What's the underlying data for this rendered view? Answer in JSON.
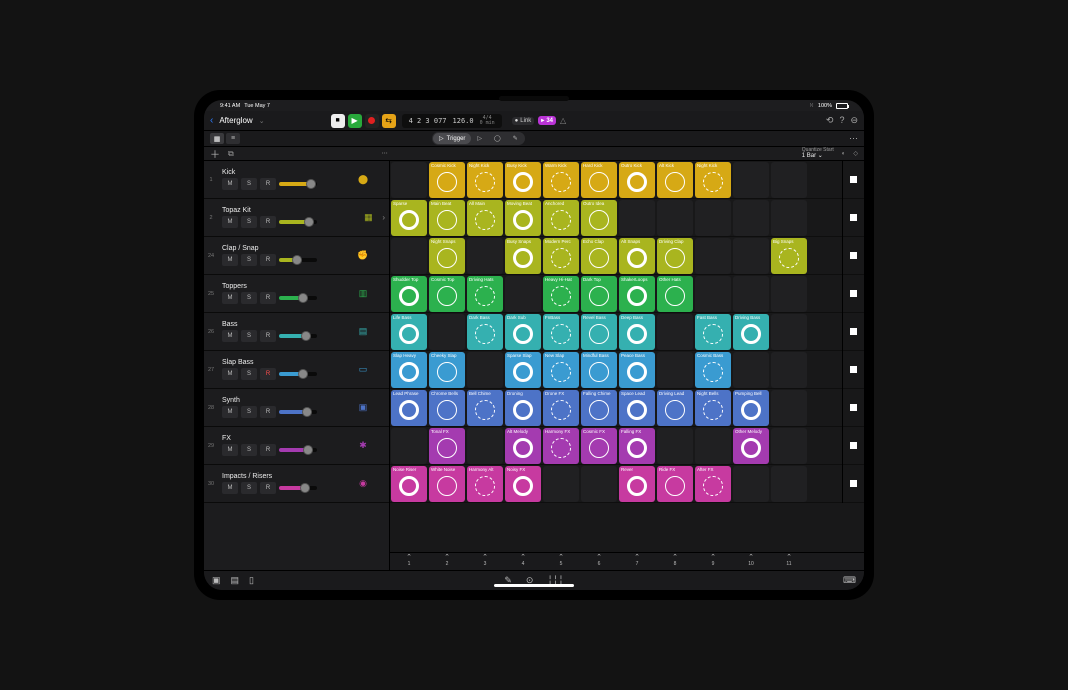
{
  "status": {
    "time": "9:41 AM",
    "date": "Tue May 7",
    "battery": "100%"
  },
  "project": {
    "title": "Afterglow"
  },
  "transport": {
    "position": "4 2 3 077",
    "tempo": "126.0",
    "sig": "4/4",
    "elapsed": "0 min",
    "link_label": "Link",
    "take": "34"
  },
  "subbar": {
    "trigger": "Trigger"
  },
  "info": {
    "quantize_label": "Quantize Start",
    "quantize_value": "1 Bar"
  },
  "colors": {
    "yellow": "#d6a915",
    "olive": "#a9b51f",
    "green": "#2cb14e",
    "teal": "#35b0b0",
    "sky": "#3a9bd1",
    "blue": "#4d73c7",
    "purple": "#a43bb0",
    "magenta": "#c73aa0"
  },
  "tracks": [
    {
      "num": "1",
      "name": "Kick",
      "color": "yellow",
      "icon": "⬤",
      "fader": 0.78
    },
    {
      "num": "2",
      "name": "Topaz Kit",
      "color": "olive",
      "icon": "▦",
      "fader": 0.72,
      "expand": true
    },
    {
      "num": "24",
      "name": "Clap / Snap",
      "color": "olive",
      "icon": "✊",
      "fader": 0.4
    },
    {
      "num": "25",
      "name": "Toppers",
      "color": "green",
      "icon": "▥",
      "fader": 0.56
    },
    {
      "num": "26",
      "name": "Bass",
      "color": "teal",
      "icon": "▤",
      "fader": 0.64
    },
    {
      "num": "27",
      "name": "Slap Bass",
      "color": "sky",
      "icon": "▭",
      "fader": 0.55,
      "rec": true
    },
    {
      "num": "28",
      "name": "Synth",
      "color": "blue",
      "icon": "▣",
      "fader": 0.66
    },
    {
      "num": "29",
      "name": "FX",
      "color": "purple",
      "icon": "✱",
      "fader": 0.7
    },
    {
      "num": "30",
      "name": "Impacts / Risers",
      "color": "magenta",
      "icon": "◉",
      "fader": 0.6
    }
  ],
  "grid": [
    [
      null,
      {
        "n": "Cosmic Kick"
      },
      {
        "n": "Night Kick"
      },
      {
        "n": "Busy Kick"
      },
      {
        "n": "Warm Kick"
      },
      {
        "n": "Hard Kick"
      },
      {
        "n": "Outro Kick"
      },
      {
        "n": "Alt Kick"
      },
      {
        "n": "Night Kick"
      },
      null,
      null
    ],
    [
      {
        "n": "Sparse"
      },
      {
        "n": "Main Beat"
      },
      {
        "n": "All Main"
      },
      {
        "n": "Moving Beat"
      },
      {
        "n": "Anchored"
      },
      {
        "n": "Outro Idea"
      },
      null,
      null,
      null,
      null,
      null
    ],
    [
      null,
      {
        "n": "Night Snaps"
      },
      null,
      {
        "n": "Busy Snaps"
      },
      {
        "n": "Modern Perc"
      },
      {
        "n": "Echo Clap"
      },
      {
        "n": "Alt Snaps"
      },
      {
        "n": "Driving Clap"
      },
      null,
      null,
      {
        "n": "Big Snaps"
      }
    ],
    [
      {
        "n": "Shudder Top"
      },
      {
        "n": "Cosmic Top"
      },
      {
        "n": "Driving Hats"
      },
      null,
      {
        "n": "Heavy Hi-Hat"
      },
      {
        "n": "Dark Top"
      },
      {
        "n": "ShakerLoops"
      },
      {
        "n": "Other Hats"
      },
      null,
      null,
      null
    ],
    [
      {
        "n": "Life Bass"
      },
      null,
      {
        "n": "Dark Bass"
      },
      {
        "n": "Dark Sub"
      },
      {
        "n": "FnBass"
      },
      {
        "n": "Revel Bass"
      },
      {
        "n": "Deep Bass"
      },
      null,
      {
        "n": "Fast Bass"
      },
      {
        "n": "Driving Bass"
      },
      null
    ],
    [
      {
        "n": "Slap Heavy"
      },
      {
        "n": "Cheeky Slap"
      },
      null,
      {
        "n": "Sparse Slap"
      },
      {
        "n": "New Slap"
      },
      {
        "n": "Mindful Bass"
      },
      {
        "n": "Peace Bass"
      },
      null,
      {
        "n": "Cosmic Bass"
      },
      null,
      null
    ],
    [
      {
        "n": "Lead Phrase"
      },
      {
        "n": "Chrome Bells"
      },
      {
        "n": "Bell Chime"
      },
      {
        "n": "Droning"
      },
      {
        "n": "Drone FX"
      },
      {
        "n": "Falling Chime"
      },
      {
        "n": "Space Lead"
      },
      {
        "n": "Driving Lead"
      },
      {
        "n": "Night Bells"
      },
      {
        "n": "Pumping Bell"
      },
      null
    ],
    [
      null,
      {
        "n": "Tonal FX"
      },
      null,
      {
        "n": "Alt Melody"
      },
      {
        "n": "Harmony FX"
      },
      {
        "n": "Cosmic FX"
      },
      {
        "n": "Falling FX"
      },
      null,
      null,
      {
        "n": "Other Melody"
      },
      null
    ],
    [
      {
        "n": "Noise Riser"
      },
      {
        "n": "White Noise"
      },
      {
        "n": "Harmony Alt"
      },
      {
        "n": "Noisy FX"
      },
      null,
      null,
      {
        "n": "Rever"
      },
      {
        "n": "Ride FX"
      },
      {
        "n": "After FX"
      },
      null,
      null
    ]
  ],
  "scenes": [
    "1",
    "2",
    "3",
    "4",
    "5",
    "6",
    "7",
    "8",
    "9",
    "10",
    "11"
  ],
  "msr": {
    "m": "M",
    "s": "S",
    "r": "R"
  }
}
